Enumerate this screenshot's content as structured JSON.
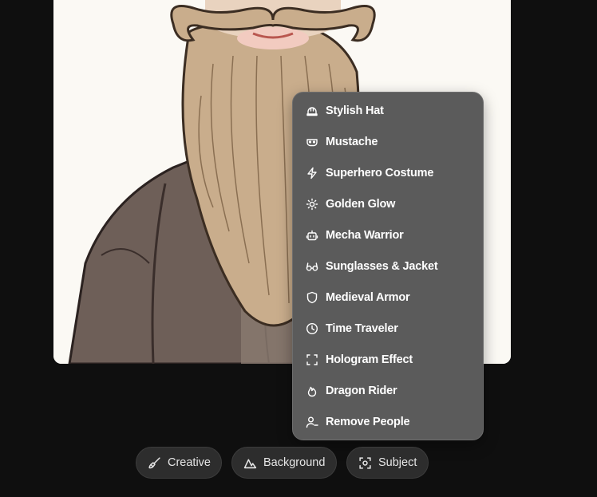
{
  "image": {
    "subject": "illustrated bearded man with curled mustache"
  },
  "menu": {
    "items": [
      {
        "label": "Stylish Hat",
        "icon": "hard-hat-icon"
      },
      {
        "label": "Mustache",
        "icon": "mask-icon"
      },
      {
        "label": "Superhero Costume",
        "icon": "lightning-icon"
      },
      {
        "label": "Golden Glow",
        "icon": "sun-icon"
      },
      {
        "label": "Mecha Warrior",
        "icon": "robot-icon"
      },
      {
        "label": "Sunglasses & Jacket",
        "icon": "glasses-icon"
      },
      {
        "label": "Medieval Armor",
        "icon": "shield-icon"
      },
      {
        "label": "Time Traveler",
        "icon": "clock-icon"
      },
      {
        "label": "Hologram Effect",
        "icon": "scan-frame-icon"
      },
      {
        "label": "Dragon Rider",
        "icon": "flame-icon"
      },
      {
        "label": "Remove People",
        "icon": "user-minus-icon"
      }
    ]
  },
  "toolbar": {
    "creative_label": "Creative",
    "background_label": "Background",
    "subject_label": "Subject"
  },
  "colors": {
    "page_bg": "#0f0f0f",
    "menu_bg": "#5b5b5b",
    "pill_bg": "#2d2d2d",
    "text": "#ffffff"
  }
}
